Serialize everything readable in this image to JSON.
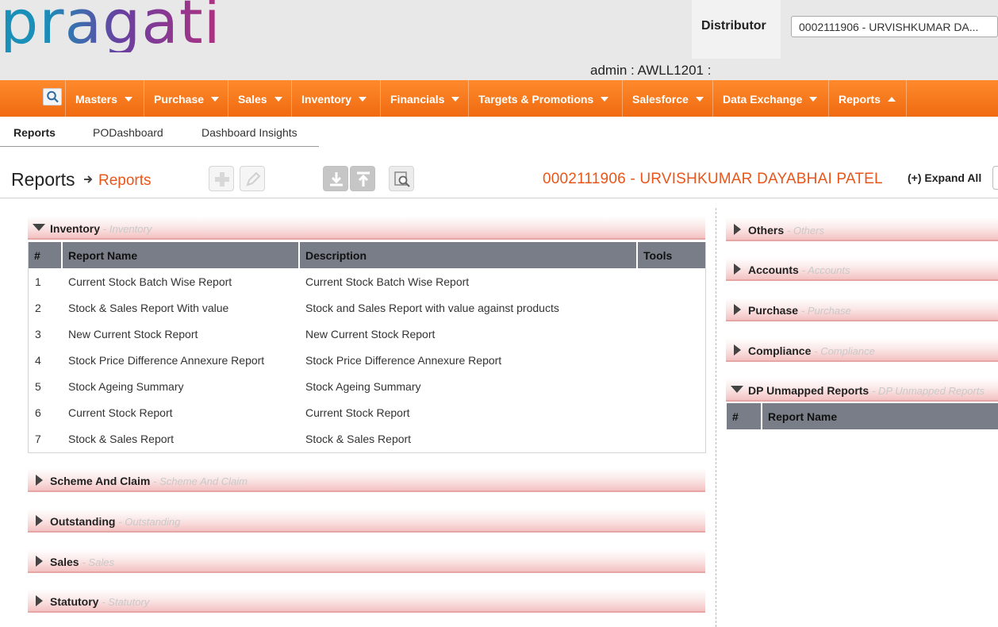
{
  "brand": {
    "logo_text": "pragati"
  },
  "header": {
    "distributor_label": "Distributor",
    "distributor_value": "0002111906 - URVISHKUMAR DA...",
    "admin_text": "admin : AWLL1201 :"
  },
  "nav": {
    "items": [
      {
        "label": "Masters"
      },
      {
        "label": "Purchase"
      },
      {
        "label": "Sales"
      },
      {
        "label": "Inventory"
      },
      {
        "label": "Financials"
      },
      {
        "label": "Targets & Promotions"
      },
      {
        "label": "Salesforce"
      },
      {
        "label": "Data Exchange"
      },
      {
        "label": "Reports"
      }
    ]
  },
  "subtabs": [
    {
      "label": "Reports"
    },
    {
      "label": "PODashboard"
    },
    {
      "label": "Dashboard Insights"
    }
  ],
  "breadcrumb": {
    "title": "Reports",
    "current": "Reports"
  },
  "distributor_heading": "0002111906 - URVISHKUMAR DAYABHAI PATEL",
  "expand_all_label": "(+) Expand All",
  "left_sections": [
    {
      "title": "Inventory",
      "subtitle": "- Inventory",
      "expanded": true
    },
    {
      "title": "Scheme And Claim",
      "subtitle": "- Scheme And Claim",
      "expanded": false
    },
    {
      "title": "Outstanding",
      "subtitle": "- Outstanding",
      "expanded": false
    },
    {
      "title": "Sales",
      "subtitle": "- Sales",
      "expanded": false
    },
    {
      "title": "Statutory",
      "subtitle": "- Statutory",
      "expanded": false
    }
  ],
  "inventory_table": {
    "columns": [
      "#",
      "Report Name",
      "Description",
      "Tools"
    ],
    "rows": [
      {
        "num": "1",
        "name": "Current Stock Batch Wise Report",
        "description": "Current Stock Batch Wise Report"
      },
      {
        "num": "2",
        "name": "Stock & Sales Report With value",
        "description": "Stock and Sales Report with value against products"
      },
      {
        "num": "3",
        "name": "New Current Stock Report",
        "description": "New Current Stock Report"
      },
      {
        "num": "4",
        "name": "Stock Price Difference Annexure Report",
        "description": "Stock Price Difference Annexure Report"
      },
      {
        "num": "5",
        "name": "Stock Ageing Summary",
        "description": "Stock Ageing Summary"
      },
      {
        "num": "6",
        "name": "Current Stock Report",
        "description": "Current Stock Report"
      },
      {
        "num": "7",
        "name": "Stock & Sales Report",
        "description": "Stock & Sales Report"
      }
    ]
  },
  "right_sections": [
    {
      "title": "Others",
      "subtitle": "- Others",
      "expanded": false
    },
    {
      "title": "Accounts",
      "subtitle": "- Accounts",
      "expanded": false
    },
    {
      "title": "Purchase",
      "subtitle": "- Purchase",
      "expanded": false
    },
    {
      "title": "Compliance",
      "subtitle": "- Compliance",
      "expanded": false
    },
    {
      "title": "DP Unmapped Reports",
      "subtitle": "- DP Unmapped Reports",
      "expanded": true
    }
  ],
  "dp_table": {
    "columns": [
      "#",
      "Report Name"
    ]
  },
  "colors": {
    "accent": "#e8561b",
    "nav_orange": "#f57a1e",
    "table_header": "#787d87",
    "logo_gradient": [
      "#1a8fb8",
      "#6a3fa0",
      "#b0307f"
    ]
  },
  "icons": [
    "search-icon",
    "add-icon",
    "edit-icon",
    "download-icon",
    "upload-icon",
    "preview-icon",
    "arrow-right-icon"
  ]
}
